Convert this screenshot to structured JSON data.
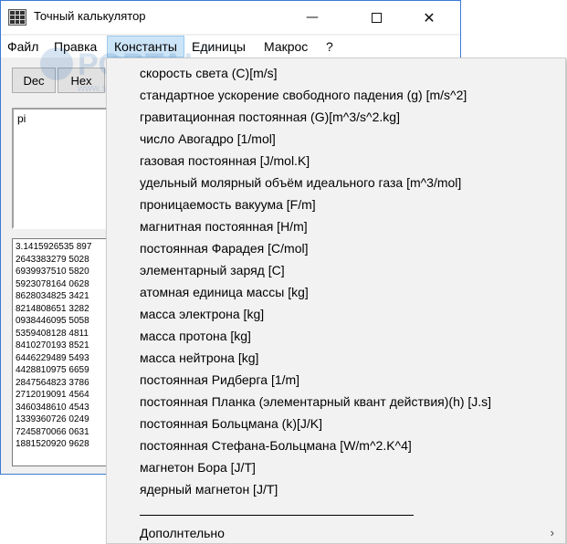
{
  "window": {
    "title": "Точный калькулятор",
    "controls": {
      "minimize": "—",
      "close": "✕"
    }
  },
  "menubar": {
    "items": [
      "Файл",
      "Правка",
      "Константы",
      "Единицы",
      "Макрос",
      "?"
    ],
    "active": "Константы"
  },
  "toolbar": {
    "buttons": [
      "Dec",
      "Hex"
    ]
  },
  "expression": {
    "value": "pi"
  },
  "result": {
    "lines": [
      "3.1415926535 897",
      "2643383279 5028",
      "6939937510 5820",
      "5923078164 0628",
      "8628034825 3421",
      "8214808651 3282",
      "0938446095 5058",
      "5359408128 4811",
      "8410270193 8521",
      "6446229489 5493",
      "4428810975 6659",
      "2847564823 3786",
      "2712019091 4564",
      "3460348610 4543",
      "1339360726 0249",
      "7245870066 0631",
      "1881520920 9628"
    ]
  },
  "constants_menu": {
    "items": [
      "скорость света (C)[m/s]",
      "стандартное ускорение свободного падения (g) [m/s^2]",
      "гравитационная постоянная (G)[m^3/s^2.kg]",
      "число Авогадро [1/mol]",
      "газовая постоянная [J/mol.K]",
      "удельный молярный объём идеального газа [m^3/mol]",
      "проницаемость вакуума [F/m]",
      "магнитная постоянная [H/m]",
      "постоянная Фарадея [C/mol]",
      "элементарный заряд [C]",
      "атомная единица массы [kg]",
      "масса электрона [kg]",
      "масса протона [kg]",
      "масса нейтрона [kg]",
      "постоянная Ридберга [1/m]",
      "постоянная Планка (элементарный квант действия)(h) [J.s]",
      "постоянная Больцмана (k)[J/K]",
      "постоянная Стефана-Больцмана [W/m^2.K^4]",
      "магнетон Бора [J/T]",
      "ядерный магнетон [J/T]"
    ],
    "more_label": "Дополнтельно",
    "more_chevron": "›"
  },
  "watermark": {
    "text": "PORTAL",
    "subtext": "www.softportal.com",
    "mark": "TM"
  },
  "colors": {
    "menu_bg": "#f2f2f2",
    "menu_highlight": "#cce4f7",
    "window_border": "#3a7bd5"
  }
}
